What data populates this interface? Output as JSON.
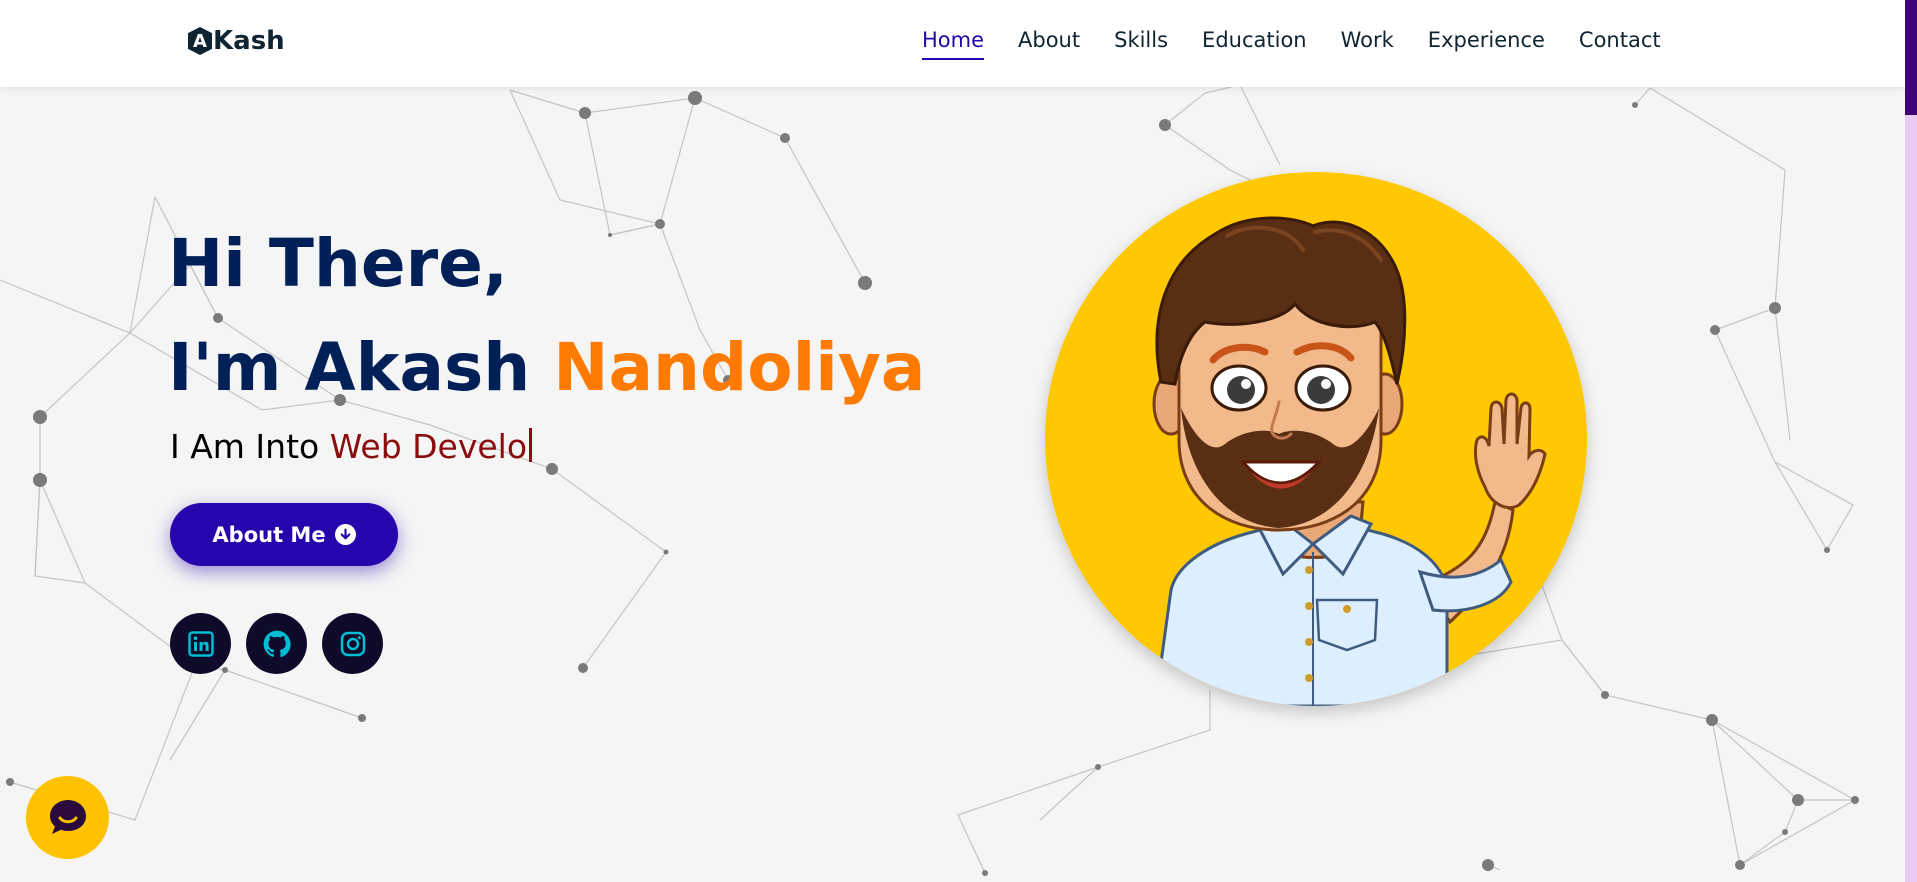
{
  "header": {
    "logo_letter": "A",
    "logo_text": "Kash",
    "nav": [
      {
        "label": "Home",
        "active": true
      },
      {
        "label": "About"
      },
      {
        "label": "Skills"
      },
      {
        "label": "Education"
      },
      {
        "label": "Work"
      },
      {
        "label": "Experience"
      },
      {
        "label": "Contact"
      }
    ]
  },
  "hero": {
    "greeting": "Hi There,",
    "intro_prefix": "I'm Akash ",
    "intro_accent": "Nandoliya",
    "sub_prefix": "I Am Into ",
    "sub_typed": "Web Develo",
    "button_label": "About Me"
  },
  "socials": [
    {
      "icon": "linkedin-icon"
    },
    {
      "icon": "github-icon"
    },
    {
      "icon": "instagram-icon"
    }
  ],
  "avatar": {
    "icon": "avatar-image"
  },
  "chat": {
    "icon": "chat-icon"
  },
  "colors": {
    "primary": "#2506ad",
    "accent": "#ff7a00",
    "heading": "#002057",
    "typed": "#8a0c0c",
    "avatar_bg": "#ffc800",
    "social_bg": "#0e0a2a",
    "social_icon": "#00bcd4",
    "chat_bg": "#ffc200",
    "scroll_thumb": "#420177"
  }
}
